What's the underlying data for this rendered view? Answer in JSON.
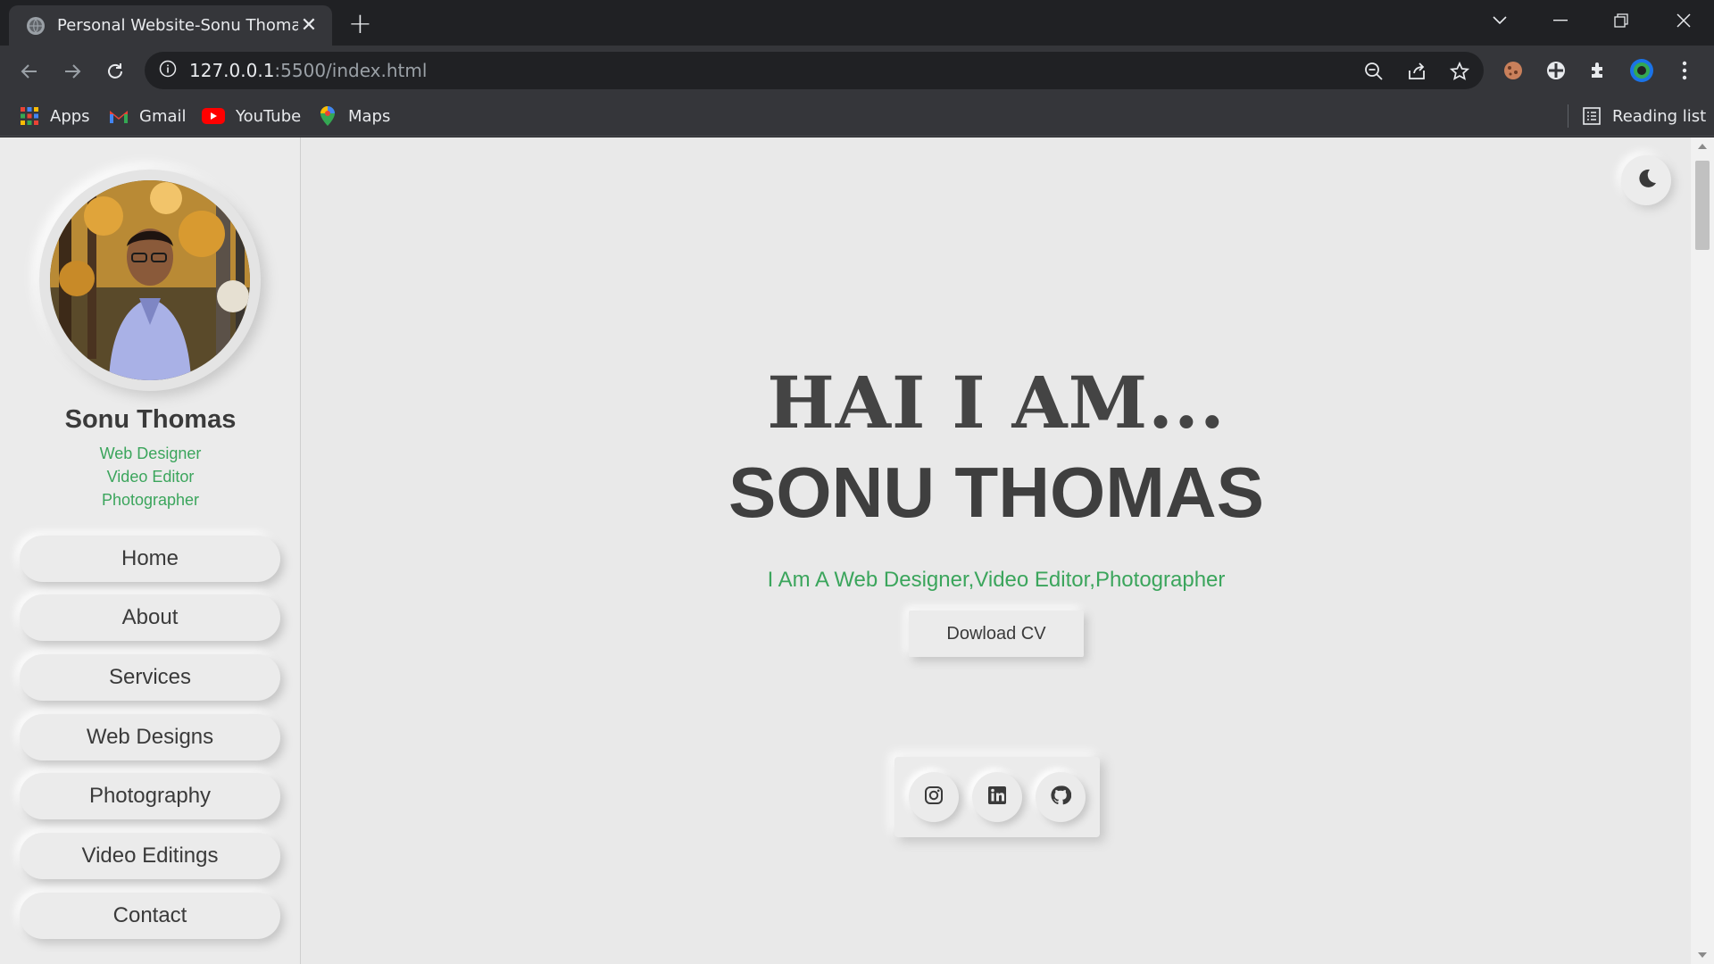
{
  "browser": {
    "tab_title": "Personal Website-Sonu Thomas",
    "url_host": "127.0.0.1",
    "url_path": ":5500/index.html",
    "bookmarks": [
      "Apps",
      "Gmail",
      "YouTube",
      "Maps"
    ],
    "reading_list": "Reading list"
  },
  "profile": {
    "name": "Sonu Thomas",
    "roles": [
      "Web Designer",
      "Video Editor",
      "Photographer"
    ]
  },
  "nav": [
    "Home",
    "About",
    "Services",
    "Web Designs",
    "Photography",
    "Video Editings",
    "Contact"
  ],
  "hero": {
    "greeting": "HAI I AM...",
    "name": "SONU THOMAS",
    "subtitle": "I Am A Web Designer,Video Editor,Photographer",
    "cv_button": "Dowload CV"
  },
  "social": [
    "instagram-icon",
    "linkedin-icon",
    "github-icon"
  ],
  "colors": {
    "accent": "#3ba55c",
    "page_bg": "#e9e9e9",
    "text": "#3a3a3a"
  }
}
